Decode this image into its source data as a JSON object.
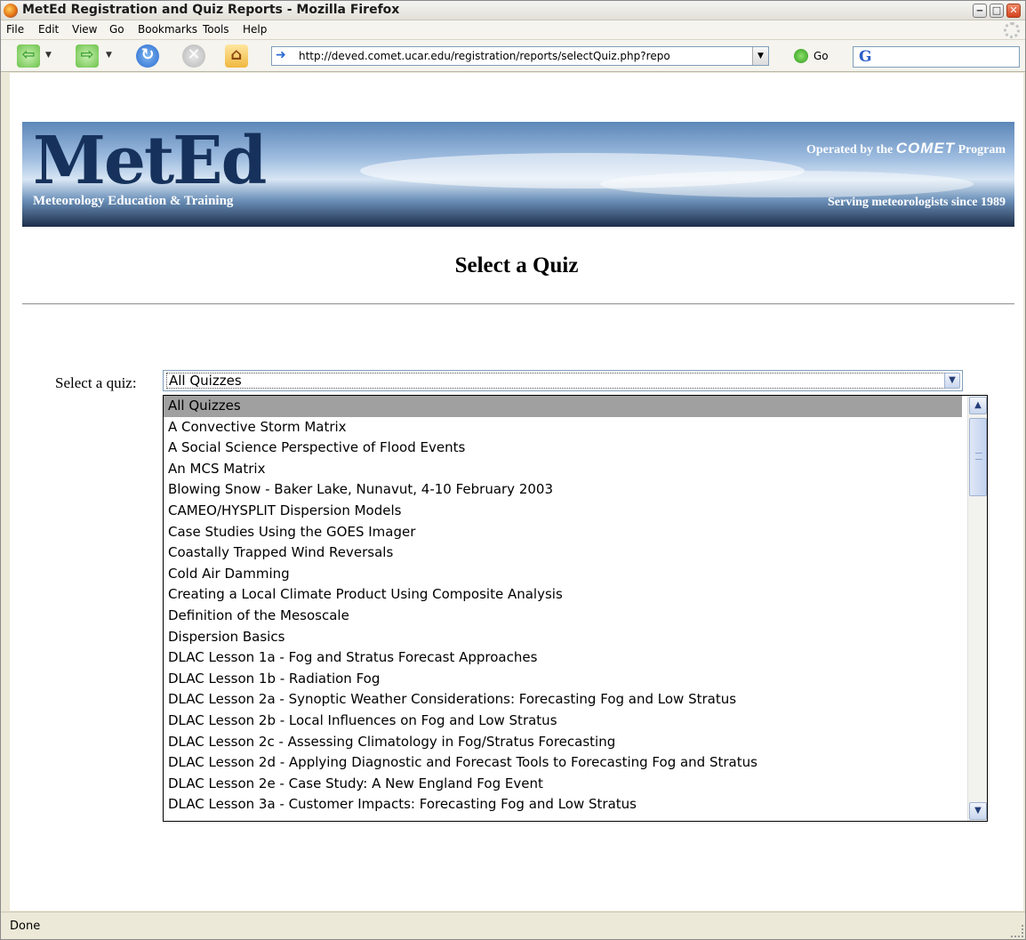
{
  "window": {
    "title": "MetEd Registration and Quiz Reports - Mozilla Firefox"
  },
  "menu": [
    "File",
    "Edit",
    "View",
    "Go",
    "Bookmarks",
    "Tools",
    "Help"
  ],
  "nav": {
    "url": "http://deved.comet.ucar.edu/registration/reports/selectQuiz.php?repo",
    "go_label": "Go",
    "search_engine_letter": "G"
  },
  "banner": {
    "logo": "MetEd",
    "tagline": "Meteorology Education & Training",
    "operated_prefix": "Operated by the",
    "operated_brand": "COMET",
    "operated_suffix": "Program",
    "serving": "Serving meteorologists since 1989"
  },
  "page": {
    "title": "Select a Quiz",
    "select_label": "Select a quiz:",
    "selected_value": "All Quizzes"
  },
  "quiz_options": [
    "All Quizzes",
    "A Convective Storm Matrix",
    "A Social Science Perspective of Flood Events",
    "An MCS Matrix",
    "Blowing Snow - Baker Lake, Nunavut, 4-10 February 2003",
    "CAMEO/HYSPLIT Dispersion Models",
    "Case Studies Using the GOES Imager",
    "Coastally Trapped Wind Reversals",
    "Cold Air Damming",
    "Creating a Local Climate Product Using Composite Analysis",
    "Definition of the Mesoscale",
    "Dispersion Basics",
    "DLAC Lesson 1a - Fog and Stratus Forecast Approaches",
    "DLAC Lesson 1b - Radiation Fog",
    "DLAC Lesson 2a - Synoptic Weather Considerations: Forecasting Fog and Low Stratus",
    "DLAC Lesson 2b - Local Influences on Fog and Low Stratus",
    "DLAC Lesson 2c - Assessing Climatology in Fog/Stratus Forecasting",
    "DLAC Lesson 2d - Applying Diagnostic and Forecast Tools to Forecasting Fog and Stratus",
    "DLAC Lesson 2e - Case Study: A New England Fog Event",
    "DLAC Lesson 3a - Customer Impacts: Forecasting Fog and Low Stratus"
  ],
  "status": {
    "text": "Done"
  }
}
